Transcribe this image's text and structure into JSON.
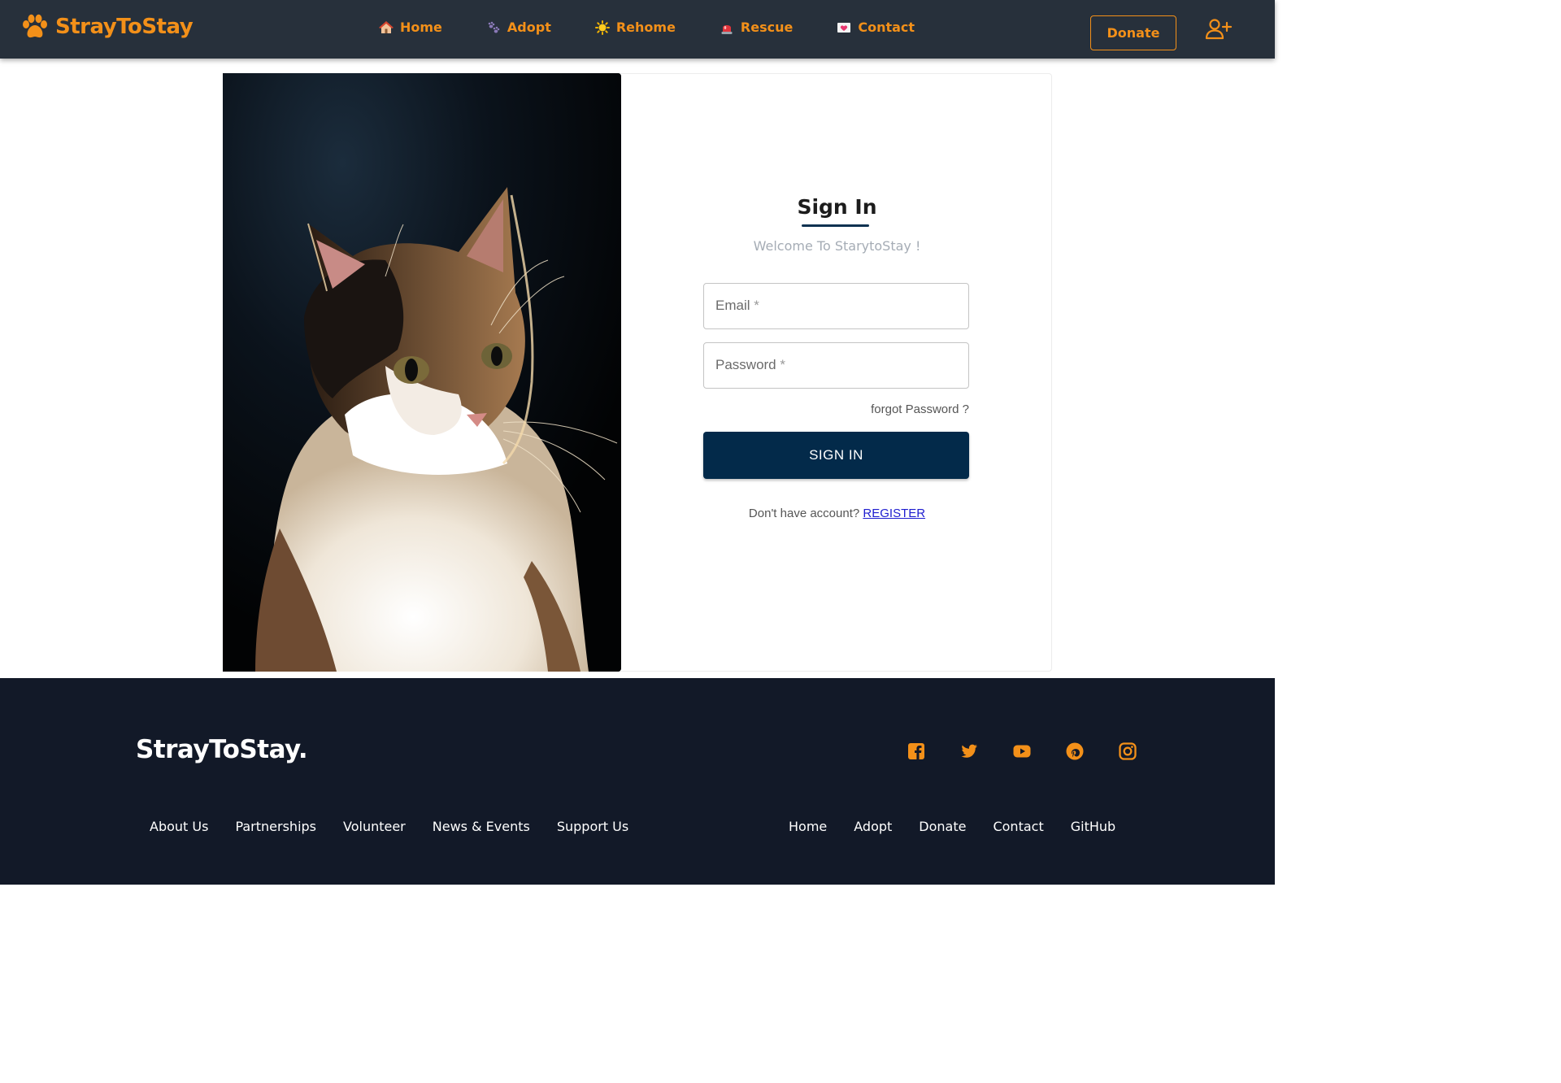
{
  "navbar": {
    "brand": "StrayToStay",
    "links": [
      {
        "label": "Home",
        "icon": "house-icon"
      },
      {
        "label": "Adopt",
        "icon": "paw-prints-icon"
      },
      {
        "label": "Rehome",
        "icon": "sun-icon"
      },
      {
        "label": "Rescue",
        "icon": "siren-icon"
      },
      {
        "label": "Contact",
        "icon": "love-letter-icon"
      }
    ],
    "donate_label": "Donate",
    "user_icon": "user-add-icon"
  },
  "signin": {
    "title": "Sign In",
    "subtitle": "Welcome To StarytoStay !",
    "email_label": "Email",
    "password_label": "Password",
    "required_mark": "*",
    "forgot": "forgot Password ?",
    "button": "SIGN IN",
    "no_account": "Don't have account?",
    "register": "REGISTER"
  },
  "photo": {
    "subject": "calico-cat-photo"
  },
  "footer": {
    "brand": "StrayToStay.",
    "socials": [
      "facebook-icon",
      "twitter-icon",
      "youtube-icon",
      "pinterest-icon",
      "instagram-icon"
    ],
    "links_left": [
      "About Us",
      "Partnerships",
      "Volunteer",
      "News & Events",
      "Support Us"
    ],
    "links_right": [
      "Home",
      "Adopt",
      "Donate",
      "Contact",
      "GitHub"
    ]
  },
  "colors": {
    "accent": "#f39019",
    "navbar_bg": "#27303b",
    "footer_bg": "#121928",
    "primary_button": "#032a4a",
    "link": "#1d1ccf"
  }
}
